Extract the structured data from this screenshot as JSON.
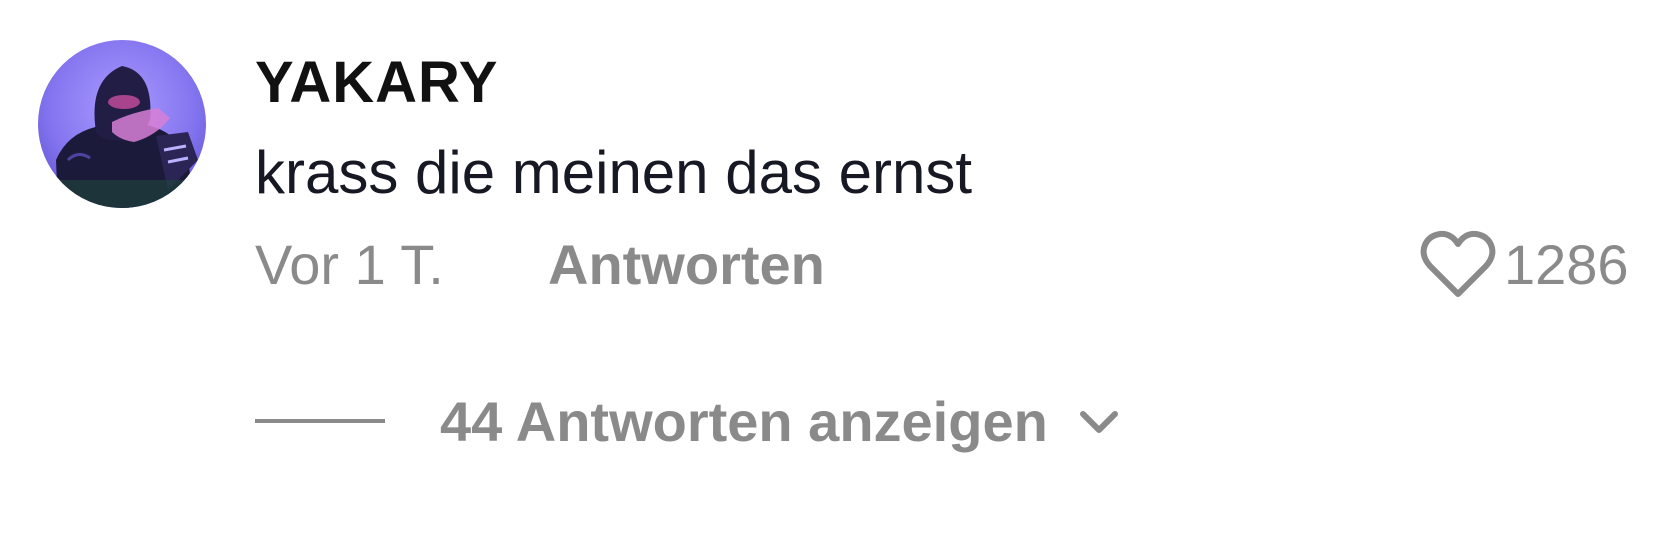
{
  "comment": {
    "username": "YAKARY",
    "text": "krass die meinen das ernst",
    "timestamp": "Vor 1 T.",
    "reply_label": "Antworten",
    "like_count": "1286",
    "view_replies_label": "44 Antworten anzeigen"
  },
  "icons": {
    "like": "heart-outline-icon",
    "expand": "chevron-down-icon"
  },
  "colors": {
    "username": "#111111",
    "comment_text": "#161823",
    "secondary_text": "#8a8a8a",
    "avatar_bg": "#8f7fff"
  }
}
